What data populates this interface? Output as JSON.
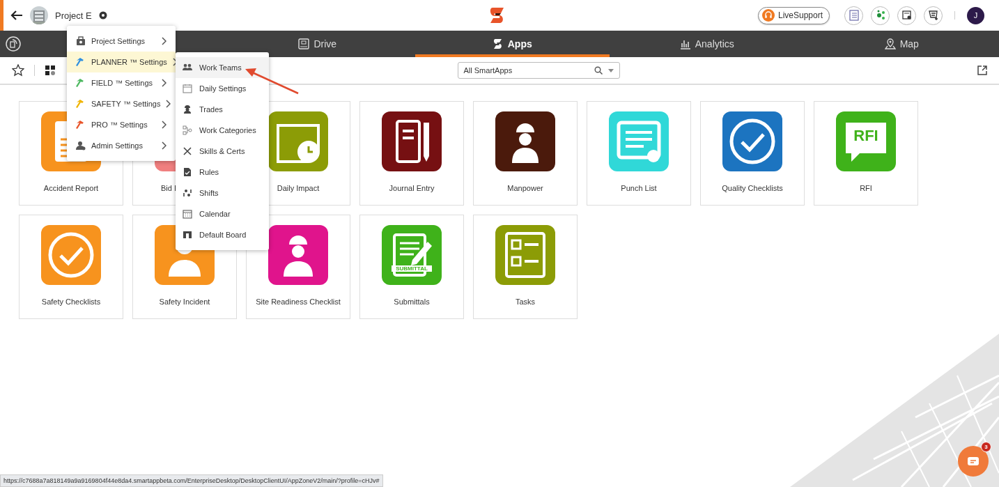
{
  "header": {
    "project": "Project E",
    "live_support": "LiveSupport",
    "avatar": "J"
  },
  "nav": {
    "tabs": [
      {
        "label": "Drive",
        "selected": false
      },
      {
        "label": "Apps",
        "selected": true
      },
      {
        "label": "Analytics",
        "selected": false
      },
      {
        "label": "Map",
        "selected": false
      }
    ]
  },
  "toolbar": {
    "search": {
      "value": "All SmartApps"
    }
  },
  "tiles": [
    {
      "label": "Accident Report",
      "color": "#f7931e",
      "clipped": false
    },
    {
      "label": "Bid I",
      "color": "#f07f7f",
      "clipped": true
    },
    {
      "label": "Daily Impact",
      "color": "#8c9c06",
      "clipped": false
    },
    {
      "label": "Journal Entry",
      "color": "#761012",
      "clipped": false
    },
    {
      "label": "Manpower",
      "color": "#4b1a0c",
      "clipped": false
    },
    {
      "label": "Punch List",
      "color": "#30d8d8",
      "clipped": false
    },
    {
      "label": "Quality Checklists",
      "color": "#1c74c0",
      "clipped": false
    },
    {
      "label": "RFI",
      "color": "#3fb21a",
      "clipped": false,
      "icon_text": "RFI"
    },
    {
      "label": "Safety Checklists",
      "color": "#f7931e",
      "clipped": false
    },
    {
      "label": "Safety Incident",
      "color": "#f7931e",
      "clipped": false
    },
    {
      "label": "Site Readiness Checklist",
      "color": "#e0148c",
      "clipped": false
    },
    {
      "label": "Submittals",
      "color": "#3fb21a",
      "clipped": false,
      "icon_text": "SUBMITTAL"
    },
    {
      "label": "Tasks",
      "color": "#8c9c06",
      "clipped": false
    }
  ],
  "settings_menu": {
    "items": [
      {
        "label": "Project Settings",
        "selected": false,
        "color": "#555555"
      },
      {
        "label": "PLANNER ™ Settings",
        "selected": true,
        "color": "#2f8fe0"
      },
      {
        "label": "FIELD ™ Settings",
        "selected": false,
        "color": "#4cb860"
      },
      {
        "label": "SAFETY ™ Settings",
        "selected": false,
        "color": "#f0b400"
      },
      {
        "label": "PRO ™ Settings",
        "selected": false,
        "color": "#e8542a"
      },
      {
        "label": "Admin Settings",
        "selected": false,
        "color": "#555555"
      }
    ]
  },
  "planner_menu": {
    "items": [
      {
        "label": "Work Teams",
        "selected": true
      },
      {
        "label": "Daily Settings",
        "selected": false
      },
      {
        "label": "Trades",
        "selected": false
      },
      {
        "label": "Work Categories",
        "selected": false
      },
      {
        "label": "Skills & Certs",
        "selected": false
      },
      {
        "label": "Rules",
        "selected": false
      },
      {
        "label": "Shifts",
        "selected": false
      },
      {
        "label": "Calendar",
        "selected": false
      },
      {
        "label": "Default Board",
        "selected": false
      }
    ]
  },
  "status_bar": {
    "url": "https://c7688a7a818149a9a9169804f44e8da4.smartappbeta.com/EnterpriseDesktop/DesktopClientUI/AppZoneV2/main/?profile=cHJv#"
  },
  "chat": {
    "badge": "3"
  }
}
